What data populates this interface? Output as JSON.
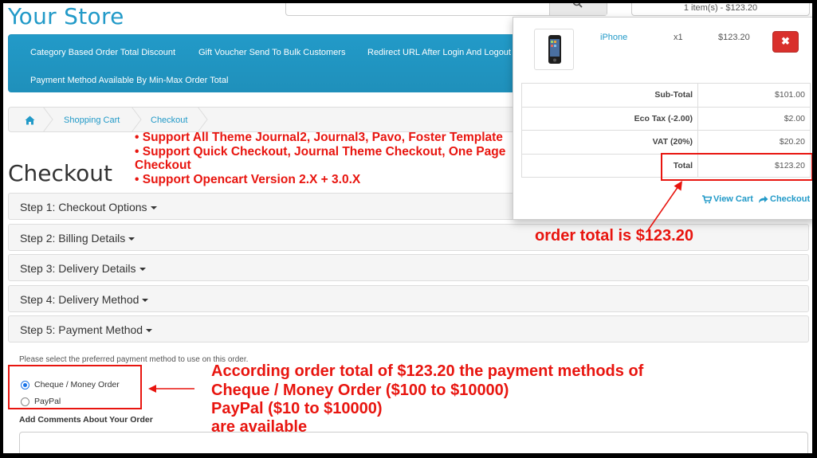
{
  "header": {
    "store_name": "Your Store",
    "search_placeholder": "Search",
    "cart_summary": "1 item(s) - $123.20"
  },
  "menu": {
    "items": [
      "Category Based Order Total Discount",
      "Gift Voucher Send To Bulk Customers",
      "Redirect URL After Login And Logout",
      "Payment Method Available By Min-Max Order Total"
    ]
  },
  "breadcrumb": {
    "items": [
      "Shopping Cart",
      "Checkout"
    ]
  },
  "promo": {
    "lines": [
      "• Support All Theme Journal2, Journal3, Pavo, Foster Template",
      "• Support Quick Checkout, Journal Theme Checkout, One Page",
      "Checkout",
      "• Support Opencart Version 2.X + 3.0.X"
    ]
  },
  "page": {
    "title": "Checkout"
  },
  "steps": [
    "Step 1: Checkout Options",
    "Step 2: Billing Details",
    "Step 3: Delivery Details",
    "Step 4: Delivery Method",
    "Step 5: Payment Method"
  ],
  "payment": {
    "instruction": "Please select the preferred payment method to use on this order.",
    "options": [
      {
        "label": "Cheque / Money Order",
        "checked": true
      },
      {
        "label": "PayPal",
        "checked": false
      }
    ],
    "comments_label": "Add Comments About Your Order"
  },
  "cart_dropdown": {
    "item": {
      "name": "iPhone",
      "qty": "x1",
      "price": "$123.20"
    },
    "totals": [
      {
        "label": "Sub-Total",
        "value": "$101.00"
      },
      {
        "label": "Eco Tax (-2.00)",
        "value": "$2.00"
      },
      {
        "label": "VAT (20%)",
        "value": "$20.20"
      },
      {
        "label": "Total",
        "value": "$123.20"
      }
    ],
    "view_cart": "View Cart",
    "checkout": "Checkout"
  },
  "annotations": {
    "order_total": "order total is $123.20",
    "methods": [
      "According order total of $123.20 the payment methods of",
      "Cheque / Money Order ($100 to $10000)",
      "PayPal ($10 to $10000)",
      "are available"
    ]
  },
  "colors": {
    "accent": "#229ac8",
    "annotation_red": "#e8150f",
    "danger": "#d9302c"
  }
}
